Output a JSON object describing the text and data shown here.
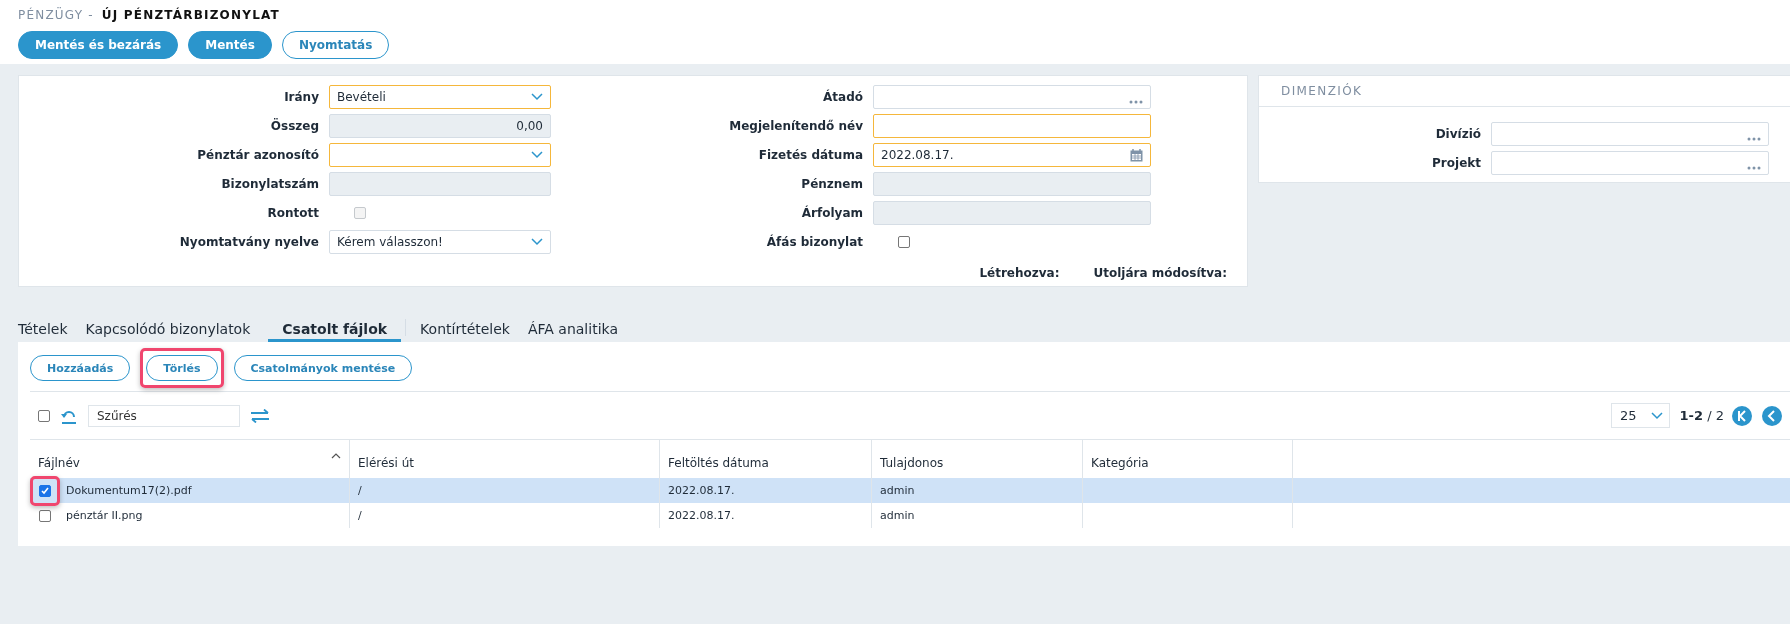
{
  "breadcrumb": {
    "section": "PÉNZÜGY -",
    "title": "ÚJ PÉNZTÁRBIZONYLAT"
  },
  "actions": [
    {
      "label": "Mentés és bezárás",
      "kind": "primary"
    },
    {
      "label": "Mentés",
      "kind": "primary"
    },
    {
      "label": "Nyomtatás",
      "kind": "outline"
    }
  ],
  "form": {
    "left": [
      {
        "label": "Irány",
        "kind": "select",
        "value": "Bevételi",
        "required": true
      },
      {
        "label": "Összeg",
        "kind": "amount",
        "value": "0,00",
        "required": false
      },
      {
        "label": "Pénztár azonosító",
        "kind": "select",
        "required": true
      },
      {
        "label": "Bizonylatszám",
        "kind": "readonly",
        "required": false
      },
      {
        "label": "Rontott",
        "kind": "checkbox",
        "checked": false,
        "disabled": true
      },
      {
        "label": "Nyomtatvány nyelve",
        "kind": "select",
        "value": "Kérem válasszon!",
        "required": false
      }
    ],
    "right": [
      {
        "label": "Átadó",
        "kind": "lookup",
        "required": false
      },
      {
        "label": "Megjelenítendő név",
        "kind": "text",
        "required": true
      },
      {
        "label": "Fizetés dátuma",
        "kind": "date",
        "value": "2022.08.17.",
        "required": true
      },
      {
        "label": "Pénznem",
        "kind": "readonly",
        "required": false
      },
      {
        "label": "Árfolyam",
        "kind": "readonly",
        "required": false
      },
      {
        "label": "Áfás bizonylat",
        "kind": "checkbox",
        "checked": false,
        "disabled": false
      }
    ],
    "footer": [
      "Létrehozva:",
      "Utoljára módosítva:"
    ]
  },
  "dimensions": {
    "title": "DIMENZIÓK",
    "fields": [
      {
        "label": "Divízió",
        "kind": "lookup",
        "required": false
      },
      {
        "label": "Projekt",
        "kind": "lookup",
        "required": false
      }
    ]
  },
  "tabs": [
    {
      "label": "Tételek",
      "selected": false
    },
    {
      "label": "Kapcsolódó bizonylatok",
      "selected": false
    },
    {
      "label": "Csatolt fájlok",
      "selected": true
    },
    {
      "label": "Kontírtételek",
      "selected": false
    },
    {
      "label": "ÁFA analitika",
      "selected": false
    }
  ],
  "attachments": {
    "buttons": [
      {
        "label": "Hozzáadás",
        "highlighted": false
      },
      {
        "label": "Törlés",
        "highlighted": true
      },
      {
        "label": "Csatolmányok mentése",
        "highlighted": false
      }
    ],
    "select_all": {
      "checked": false
    },
    "filter": {
      "placeholder": "Szűrés"
    },
    "page_size": "25",
    "range": "**1-2** / 2",
    "columns": [
      {
        "label": "Fájlnév",
        "sorted": true
      },
      {
        "label": "Elérési út",
        "sorted": false
      },
      {
        "label": "Feltöltés dátuma",
        "sorted": false
      },
      {
        "label": "Tulajdonos",
        "sorted": false
      },
      {
        "label": "Kategória",
        "sorted": false
      }
    ],
    "rows": [
      {
        "cells": [
          "Dokumentum17(2).pdf",
          "/",
          "2022.08.17.",
          "admin"
        ],
        "selected": true,
        "checked": true,
        "highlighted": true
      },
      {
        "cells": [
          "pénztár II.png",
          "/",
          "2022.08.17.",
          "admin"
        ],
        "selected": false,
        "checked": false,
        "highlighted": false
      }
    ]
  }
}
